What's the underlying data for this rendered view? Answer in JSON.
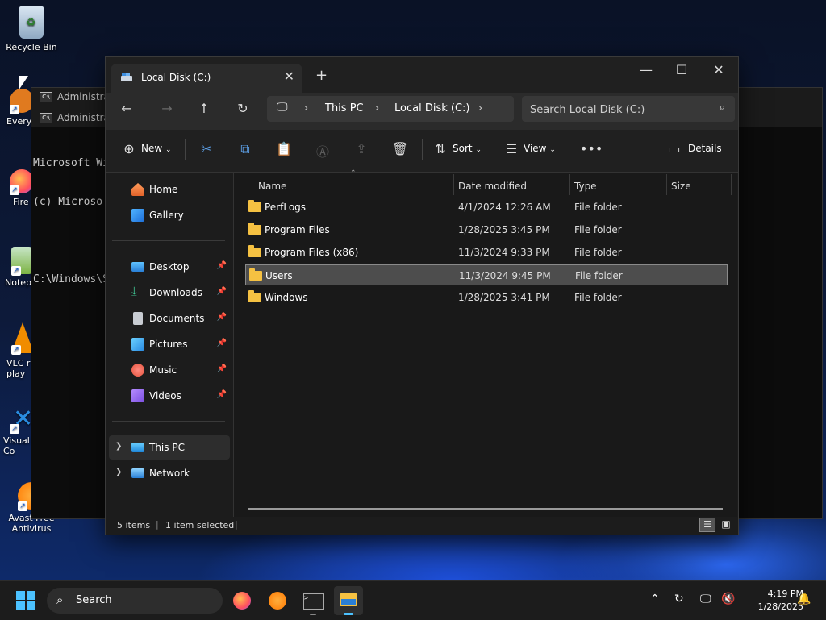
{
  "desktop": {
    "icons": [
      {
        "label": "Recycle Bin"
      },
      {
        "label": "Every"
      },
      {
        "label": "Fire"
      },
      {
        "label": "Notep"
      },
      {
        "label": "VLC r\nplay"
      },
      {
        "label": "Visual\nCo"
      },
      {
        "label": "Avast Free\nAntivirus"
      }
    ]
  },
  "cmd": {
    "tabs": [
      "Administrat",
      "Administrat"
    ],
    "lines": [
      "Microsoft Wi",
      "(c) Microso",
      "",
      "C:\\Windows\\S"
    ]
  },
  "explorer": {
    "tab_title": "Local Disk (C:)",
    "breadcrumb": [
      "This PC",
      "Local Disk (C:)"
    ],
    "search_placeholder": "Search Local Disk (C:)",
    "commands": {
      "new": "New",
      "sort": "Sort",
      "view": "View",
      "details": "Details"
    },
    "nav": {
      "home": "Home",
      "gallery": "Gallery",
      "desktop": "Desktop",
      "downloads": "Downloads",
      "documents": "Documents",
      "pictures": "Pictures",
      "music": "Music",
      "videos": "Videos",
      "this_pc": "This PC",
      "network": "Network"
    },
    "columns": {
      "name": "Name",
      "date": "Date modified",
      "type": "Type",
      "size": "Size"
    },
    "files": [
      {
        "name": "PerfLogs",
        "date": "4/1/2024 12:26 AM",
        "type": "File folder"
      },
      {
        "name": "Program Files",
        "date": "1/28/2025 3:45 PM",
        "type": "File folder"
      },
      {
        "name": "Program Files (x86)",
        "date": "11/3/2024 9:33 PM",
        "type": "File folder"
      },
      {
        "name": "Users",
        "date": "11/3/2024 9:45 PM",
        "type": "File folder",
        "selected": true
      },
      {
        "name": "Windows",
        "date": "1/28/2025 3:41 PM",
        "type": "File folder"
      }
    ],
    "status": {
      "items": "5 items",
      "selected": "1 item selected"
    }
  },
  "taskbar": {
    "search_label": "Search",
    "time": "4:19 PM",
    "date": "1/28/2025"
  },
  "colors": {
    "accent": "#5a9be0",
    "folder": "#f5c142",
    "selected_row": "#4d4d4d"
  }
}
